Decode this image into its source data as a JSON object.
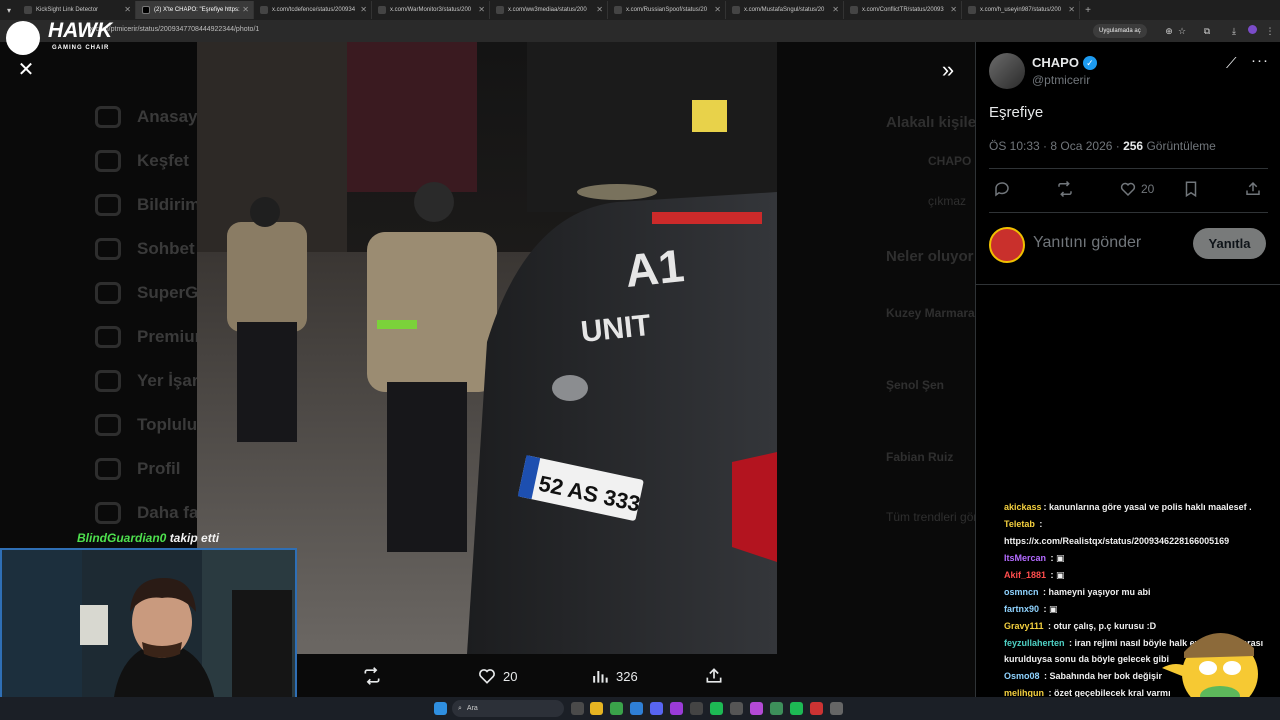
{
  "browser": {
    "tabs": [
      {
        "title": "KickSight Link Detector",
        "active": false
      },
      {
        "title": "(2) X'te CHAPO: \"Eşrefiye https:",
        "active": true
      },
      {
        "title": "x.com/tcdefence/status/200934",
        "active": false
      },
      {
        "title": "x.com/WarMonitor3/status/200",
        "active": false
      },
      {
        "title": "x.com/ww3mediaa/status/200",
        "active": false
      },
      {
        "title": "x.com/RussianSpoof/status/20",
        "active": false
      },
      {
        "title": "x.com/MustafaSngul/status/20",
        "active": false
      },
      {
        "title": "x.com/ConflictTR/status/20093",
        "active": false
      },
      {
        "title": "x.com/h_useyin987/status/200",
        "active": false
      }
    ],
    "url": "x.com/ptmicerir/status/2009347708444922344/photo/1",
    "open_in_app_label": "Uygulamada aç"
  },
  "logo": {
    "name": "HAWK",
    "sub": "GAMING CHAIR"
  },
  "background_nav": [
    "Anasayfa",
    "Keşfet",
    "Bildirimler",
    "Sohbet",
    "SuperGrok",
    "Premium",
    "Yer İşaretleri",
    "Topluluklar",
    "Profil",
    "Daha fazla"
  ],
  "background_right": {
    "related": "Alakalı kişiler",
    "related_name": "CHAPO",
    "related_cut": "çıkmaz",
    "whats_happening": "Neler oluyor",
    "trend_1": "Kuzey Marmara",
    "trend_2": "Şenol Şen",
    "trend_3": "Fabian Ruiz",
    "trend_4": "Tüm trendleri gör"
  },
  "photo_actions": {
    "retweets": "",
    "likes": "20",
    "views": "326"
  },
  "tweet": {
    "author_name": "CHAPO",
    "author_handle": "@ptmicerir",
    "text": "Eşrefiye",
    "time": "ÖS 10:33 · 8 Oca 2026 · ",
    "views_count": "256",
    "views_label": "Görüntüleme",
    "likes": "20",
    "reply_placeholder": "Yanıtını gönder",
    "reply_button": "Yanıtla"
  },
  "stream": {
    "follow_alert_name": "BlindGuardian0",
    "follow_alert_text": "takip etti",
    "chat": [
      {
        "user": "akickass",
        "color": "#f4d03f",
        "text": ": kanunlarına göre yasal ve polis haklı maalesef ."
      },
      {
        "user": "Teletab",
        "color": "#f4d03f",
        "text": " :"
      },
      {
        "user": "",
        "color": "#ffffff",
        "text": "https://x.com/Realistqx/status/2009346228166005169"
      },
      {
        "user": "ItsMercan",
        "color": "#b36bff",
        "text": " : ▣"
      },
      {
        "user": "Akif_1881",
        "color": "#ff4d4d",
        "text": " : ▣"
      },
      {
        "user": "osmncn",
        "color": "#8fd3ff",
        "text": " : hameyni yaşıyor mu abi"
      },
      {
        "user": "fartnx90",
        "color": "#8fd3ff",
        "text": " : ▣"
      },
      {
        "user": "Gravy111",
        "color": "#f4d03f",
        "text": " : otur çalış, p.ç kurusu :D"
      },
      {
        "user": "feyzullaherten",
        "color": "#4fd1c5",
        "text": " : iran rejimi nasıl böyle halk eylemleri sonrası"
      },
      {
        "user": "",
        "color": "#ffffff",
        "text": "kurulduysa sonu da böyle gelecek gibi"
      },
      {
        "user": "Osmo08",
        "color": "#8fd3ff",
        "text": " : Sabahında her bok değişir"
      },
      {
        "user": "melihgun",
        "color": "#f4d03f",
        "text": " : özet geçebilecek kral varmı"
      }
    ]
  },
  "taskbar": {
    "search_placeholder": "Ara"
  },
  "colors": {
    "accent": "#1d9bf0",
    "panel_bg": "#000000",
    "webcam_border": "#2f6fb5",
    "follow_name": "#4ee04e"
  }
}
